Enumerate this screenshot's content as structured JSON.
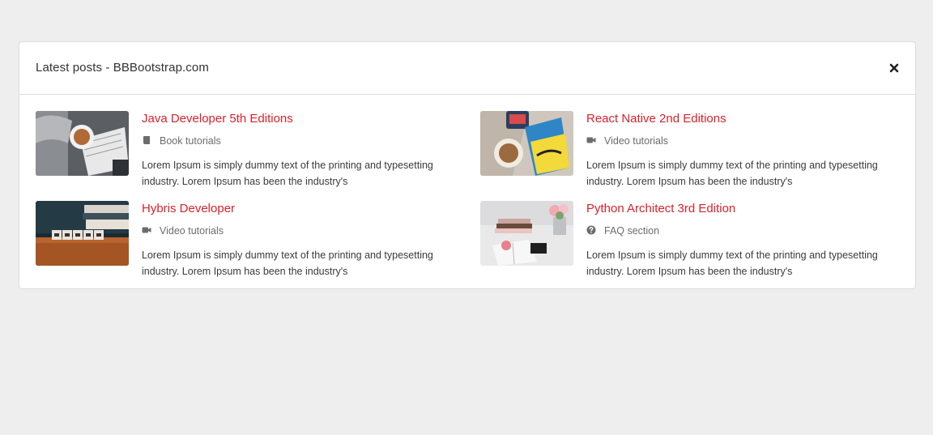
{
  "card": {
    "title": "Latest posts - BBBootstrap.com",
    "close_icon": "close-icon"
  },
  "colors": {
    "accent": "#d9222a",
    "background": "#eeeeee",
    "card": "#ffffff"
  },
  "posts": [
    {
      "title": "Java Developer 5th Editions",
      "category_icon": "book-icon",
      "category": "Book tutorials",
      "text": "Lorem Ipsum is simply dummy text of the printing and typesetting industry. Lorem Ipsum has been the industry's"
    },
    {
      "title": "React Native 2nd Editions",
      "category_icon": "video-camera-icon",
      "category": "Video tutorials",
      "text": "Lorem Ipsum is simply dummy text of the printing and typesetting industry. Lorem Ipsum has been the industry's"
    },
    {
      "title": "Hybris Developer",
      "category_icon": "video-camera-icon",
      "category": "Video tutorials",
      "text": "Lorem Ipsum is simply dummy text of the printing and typesetting industry. Lorem Ipsum has been the industry's"
    },
    {
      "title": "Python Architect 3rd Edition",
      "category_icon": "question-circle-icon",
      "category": "FAQ section",
      "text": "Lorem Ipsum is simply dummy text of the printing and typesetting industry. Lorem Ipsum has been the industry's"
    }
  ]
}
